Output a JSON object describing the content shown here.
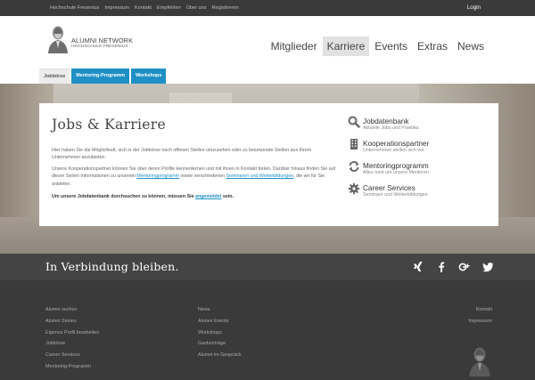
{
  "topbar": {
    "links": [
      "Hochschule Fresenius",
      "Impressum",
      "Kontakt",
      "Empfehlen",
      "Über uns",
      "Registrieren"
    ],
    "login": "Login"
  },
  "logo": {
    "title": "ALUMNI NETWORK",
    "subtitle": "HOCHSCHULE FRESENIUS"
  },
  "nav": {
    "items": [
      "Mitglieder",
      "Karriere",
      "Events",
      "Extras",
      "News"
    ],
    "active": "Karriere"
  },
  "subtabs": [
    "Jobbörse",
    "Mentoring-Programm",
    "Workshops"
  ],
  "card": {
    "title": "Jobs & Karriere",
    "p1": "Hier haben Sie die Möglichkeit, sich in der Jobbörse nach offenen Stellen umzusehen oder zu besetzende Stellen aus Ihrem Unternehmen anzubieten.",
    "p2_a": "Unsere Kooperationspartner können Sie über deren Profile kennenlernen und mit ihnen in Kontakt treten. Darüber hinaus finden Sie auf dieser Seiten Informationen zu unserem ",
    "p2_link1": "Mentoringprogramm",
    "p2_b": " sowie verschiedenen ",
    "p2_link2": "Seminaren und Weiterbildungen",
    "p2_c": ", die wir für Sie anbieten.",
    "p3_a": "Um unsere Jobdatenbank durchsuchen zu können, müssen Sie ",
    "p3_link": "angemeldet",
    "p3_b": " sein."
  },
  "side": [
    {
      "title": "Jobdatenbank",
      "sub": "Aktuelle Jobs und Praktika",
      "icon": "search-icon"
    },
    {
      "title": "Kooperationspartner",
      "sub": "Unternehmen stellen sich vor",
      "icon": "building-icon"
    },
    {
      "title": "Mentoringprogramm",
      "sub": "Alles rund um unsere Mentoren",
      "icon": "refresh-icon"
    },
    {
      "title": "Career Services",
      "sub": "Seminare und Weiterbildungen",
      "icon": "gear-icon"
    }
  ],
  "connect": {
    "title": "In Verbindung bleiben.",
    "social": [
      "xing-icon",
      "facebook-icon",
      "google-plus-icon",
      "twitter-icon"
    ]
  },
  "footer": {
    "col1": [
      "Alumni suchen",
      "Alumni Stories",
      "Eigenes Profil bearbeiten",
      "Jobbörse",
      "Career Services",
      "Mentoring-Programm"
    ],
    "col2": [
      "News",
      "Alumni Events",
      "Workshops",
      "Gastvorträge",
      "Alumni im Gespräch"
    ],
    "col3": [
      "Kontakt",
      "Impressum"
    ]
  },
  "colors": {
    "accent": "#1e90c6",
    "dark": "#3a3a3a",
    "connect_bar": "#444444"
  }
}
